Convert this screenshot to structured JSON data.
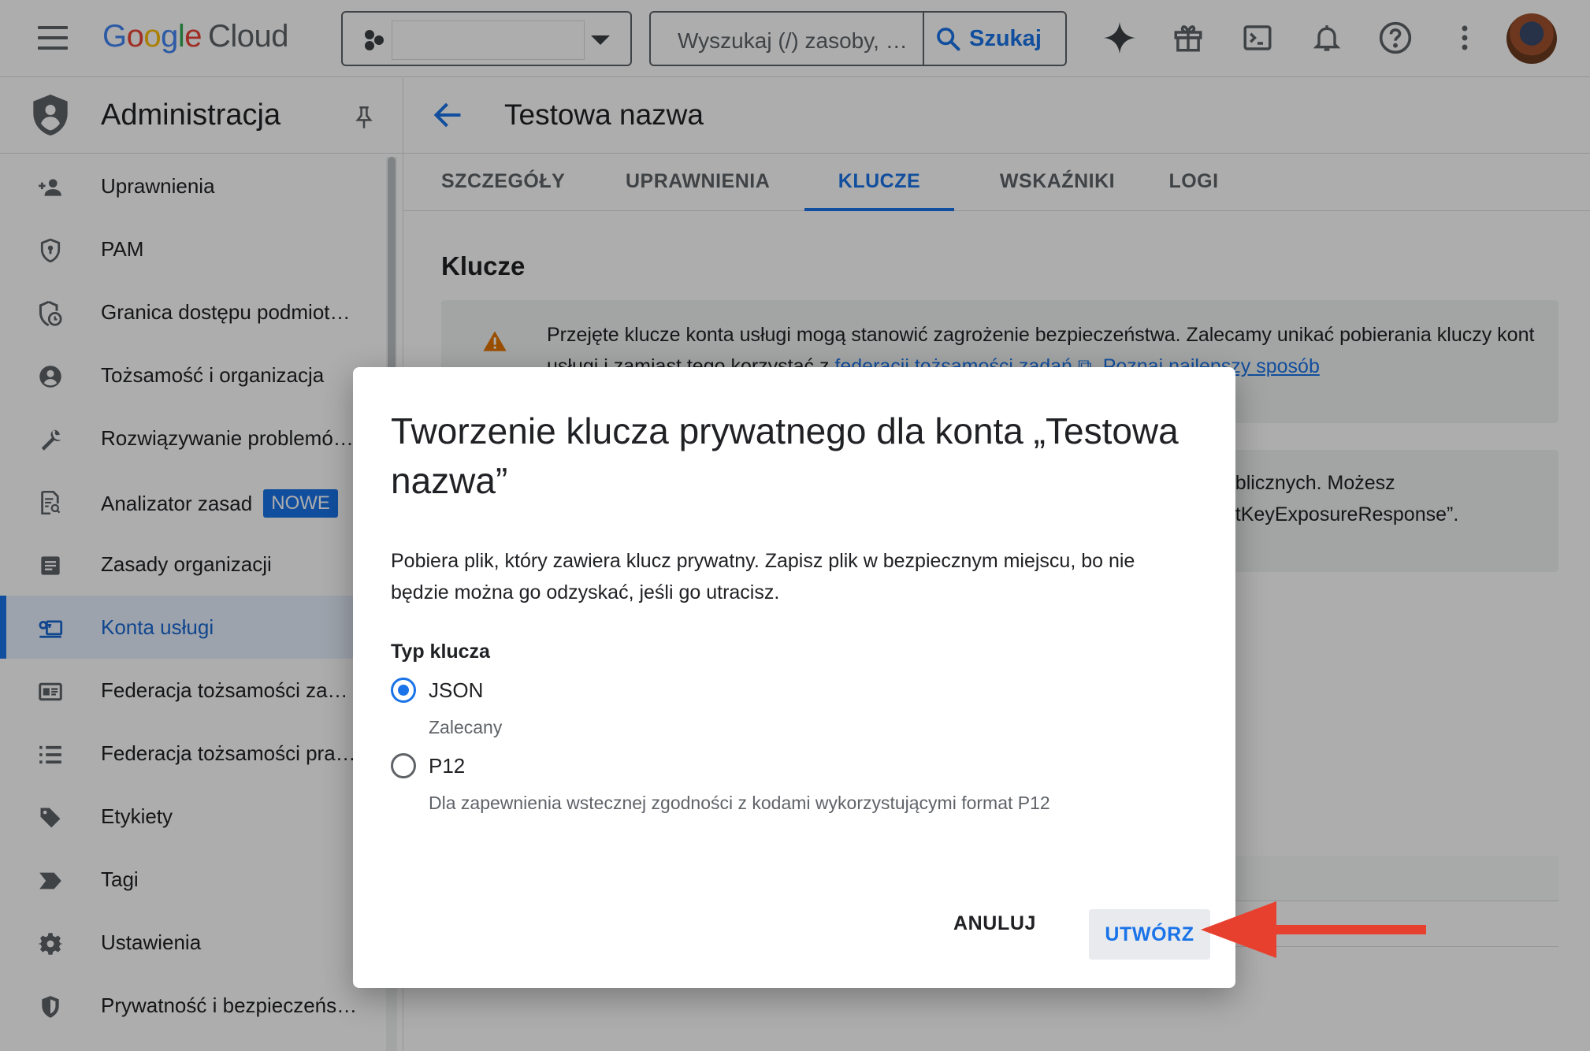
{
  "topbar": {
    "logo_google": "Google",
    "logo_cloud": "Cloud",
    "search_placeholder": "Wyszukaj (/) zasoby, d…",
    "search_button": "Szukaj"
  },
  "sidebar": {
    "title": "Administracja",
    "items": [
      {
        "label": "Uprawnienia",
        "icon": "person-add-icon"
      },
      {
        "label": "PAM",
        "icon": "shield-lock-icon"
      },
      {
        "label": "Granica dostępu podmiot…",
        "icon": "shield-clock-icon"
      },
      {
        "label": "Tożsamość i organizacja",
        "icon": "account-circle-icon"
      },
      {
        "label": "Rozwiązywanie problemó…",
        "icon": "wrench-icon"
      },
      {
        "label": "Analizator zasad",
        "icon": "policy-doc-icon",
        "badge": "NOWE"
      },
      {
        "label": "Zasady organizacji",
        "icon": "list-doc-icon"
      },
      {
        "label": "Konta usługi",
        "icon": "service-account-icon",
        "active": true
      },
      {
        "label": "Federacja tożsamości za…",
        "icon": "id-card-icon"
      },
      {
        "label": "Federacja tożsamości pra…",
        "icon": "list-icon"
      },
      {
        "label": "Etykiety",
        "icon": "tag-icon"
      },
      {
        "label": "Tagi",
        "icon": "chevron-tag-icon"
      },
      {
        "label": "Ustawienia",
        "icon": "gear-icon"
      },
      {
        "label": "Prywatność i bezpieczeńs…",
        "icon": "shield-icon"
      }
    ]
  },
  "main": {
    "title": "Testowa nazwa",
    "tabs": [
      "SZCZEGÓŁY",
      "UPRAWNIENIA",
      "KLUCZE",
      "WSKAŹNIKI",
      "LOGI"
    ],
    "active_tab": "KLUCZE",
    "section_title": "Klucze",
    "alert_text_1": "Przejęte klucze konta usługi mogą stanowić zagrożenie bezpieczeństwa. Zalecamy unikać pobierania kluczy kont usługi i zamiast tego korzystać z ",
    "alert_link_1": "federacji tożsamości zadań",
    "alert_link_2": "Poznaj najlepszy sposób",
    "info_line_1": "publicznych. Możesz",
    "info_line_2": "untKeyExposureResponse”."
  },
  "dialog": {
    "title": "Tworzenie klucza prywatnego dla konta „Testowa nazwa”",
    "description": "Pobiera plik, który zawiera klucz prywatny. Zapisz plik w bezpiecznym miejscu, bo nie będzie można go odzyskać, jeśli go utracisz.",
    "key_type_label": "Typ klucza",
    "options": [
      {
        "label": "JSON",
        "hint": "Zalecany",
        "selected": true
      },
      {
        "label": "P12",
        "hint": "Dla zapewnienia wstecznej zgodności z kodami wykorzystującymi format P12",
        "selected": false
      }
    ],
    "cancel_label": "ANULUJ",
    "create_label": "UTWÓRZ"
  },
  "colors": {
    "accent": "#1a73e8",
    "warning": "#e37400",
    "annotation_arrow": "#e8402e"
  }
}
